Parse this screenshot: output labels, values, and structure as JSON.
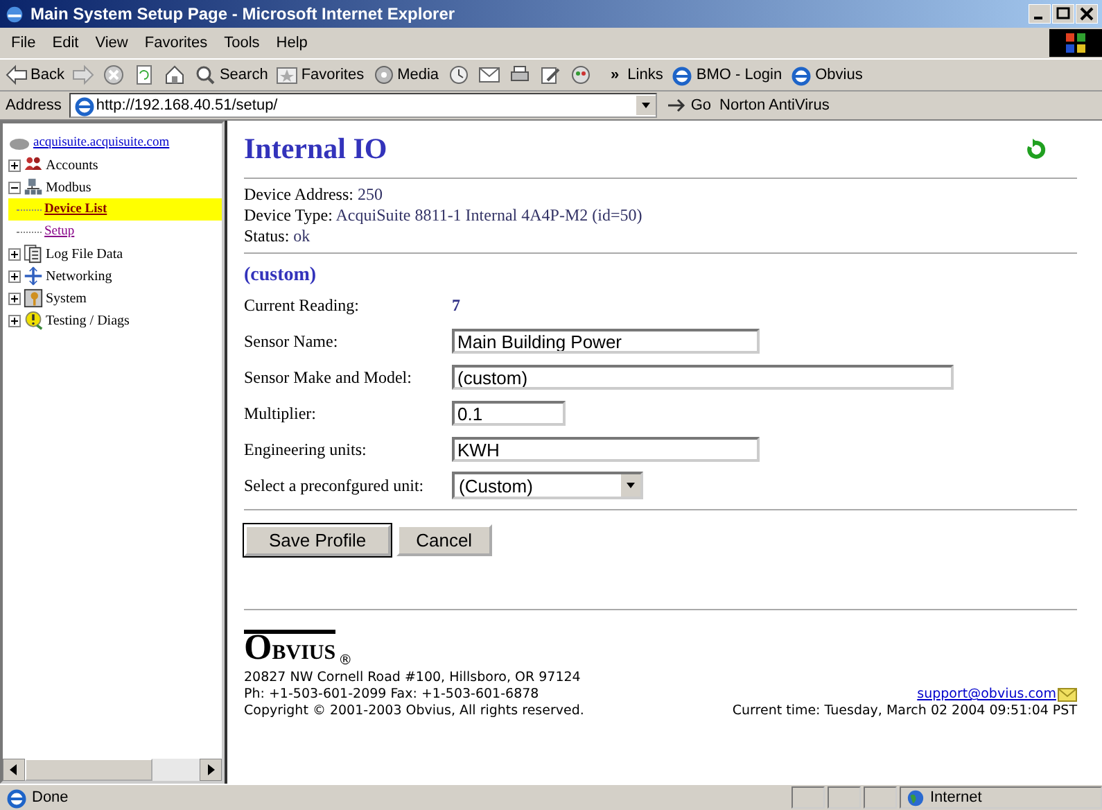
{
  "window": {
    "title": "Main System Setup Page - Microsoft Internet Explorer"
  },
  "menu": [
    "File",
    "Edit",
    "View",
    "Favorites",
    "Tools",
    "Help"
  ],
  "toolbar": [
    {
      "kind": "back",
      "label": "Back"
    },
    {
      "kind": "forward"
    },
    {
      "kind": "stop"
    },
    {
      "kind": "refresh"
    },
    {
      "kind": "home"
    },
    {
      "kind": "search",
      "label": "Search"
    },
    {
      "kind": "favorites",
      "label": "Favorites"
    },
    {
      "kind": "media",
      "label": "Media"
    },
    {
      "kind": "history"
    },
    {
      "kind": "mail"
    },
    {
      "kind": "print"
    },
    {
      "kind": "edit"
    },
    {
      "kind": "messenger"
    }
  ],
  "links": {
    "chevron": "»",
    "label": "Links",
    "items": [
      "BMO - Login",
      "Obvius"
    ]
  },
  "address": {
    "label": "Address",
    "url": "http://192.168.40.51/setup/",
    "go": "Go",
    "extra": "Norton AntiVirus"
  },
  "tree": {
    "root": "acquisuite.acquisuite.com",
    "items": [
      {
        "label": "Accounts",
        "expanded": false,
        "selected": false
      },
      {
        "label": "Modbus",
        "expanded": true,
        "selected": false,
        "children": [
          {
            "label": "Device List",
            "selected": true
          },
          {
            "label": "Setup",
            "selected": false
          }
        ]
      },
      {
        "label": "Log File Data",
        "expanded": false,
        "selected": false
      },
      {
        "label": "Networking",
        "expanded": false,
        "selected": false
      },
      {
        "label": "System",
        "expanded": false,
        "selected": false
      },
      {
        "label": "Testing / Diags",
        "expanded": false,
        "selected": false
      }
    ]
  },
  "page": {
    "title": "Internal IO",
    "info": [
      {
        "label": "Device Address:",
        "value": "250"
      },
      {
        "label": "Device Type:",
        "value": "AcquiSuite 8811-1 Internal 4A4P-M2 (id=50)"
      },
      {
        "label": "Status:",
        "value": "ok"
      }
    ],
    "section": "(custom)",
    "reading": {
      "label": "Current Reading:",
      "value": "7"
    },
    "fields": [
      {
        "kind": "text",
        "label": "Sensor Name:",
        "value": "Main Building Power"
      },
      {
        "kind": "text",
        "label": "Sensor Make and Model:",
        "value": "(custom)"
      },
      {
        "kind": "text",
        "label": "Multiplier:",
        "value": "0.1"
      },
      {
        "kind": "text",
        "label": "Engineering units:",
        "value": "KWH"
      },
      {
        "kind": "select",
        "label": "Select a preconfgured unit:",
        "value": "(Custom)"
      }
    ],
    "buttons": [
      "Save Profile",
      "Cancel"
    ]
  },
  "footer": {
    "logo": "O",
    "logo_rest": "BVIUS",
    "logo_mark": "®",
    "address": "20827 NW Cornell Road #100, Hillsboro, OR 97124",
    "phone": "Ph: +1-503-601-2099 Fax: +1-503-601-6878",
    "copyright": "Copyright © 2001-2003 Obvius, All rights reserved.",
    "email": "support@obvius.com",
    "time": "Current time: Tuesday, March 02 2004 09:51:04 PST"
  },
  "status_bar": {
    "text": "Done",
    "zone": "Internet"
  }
}
